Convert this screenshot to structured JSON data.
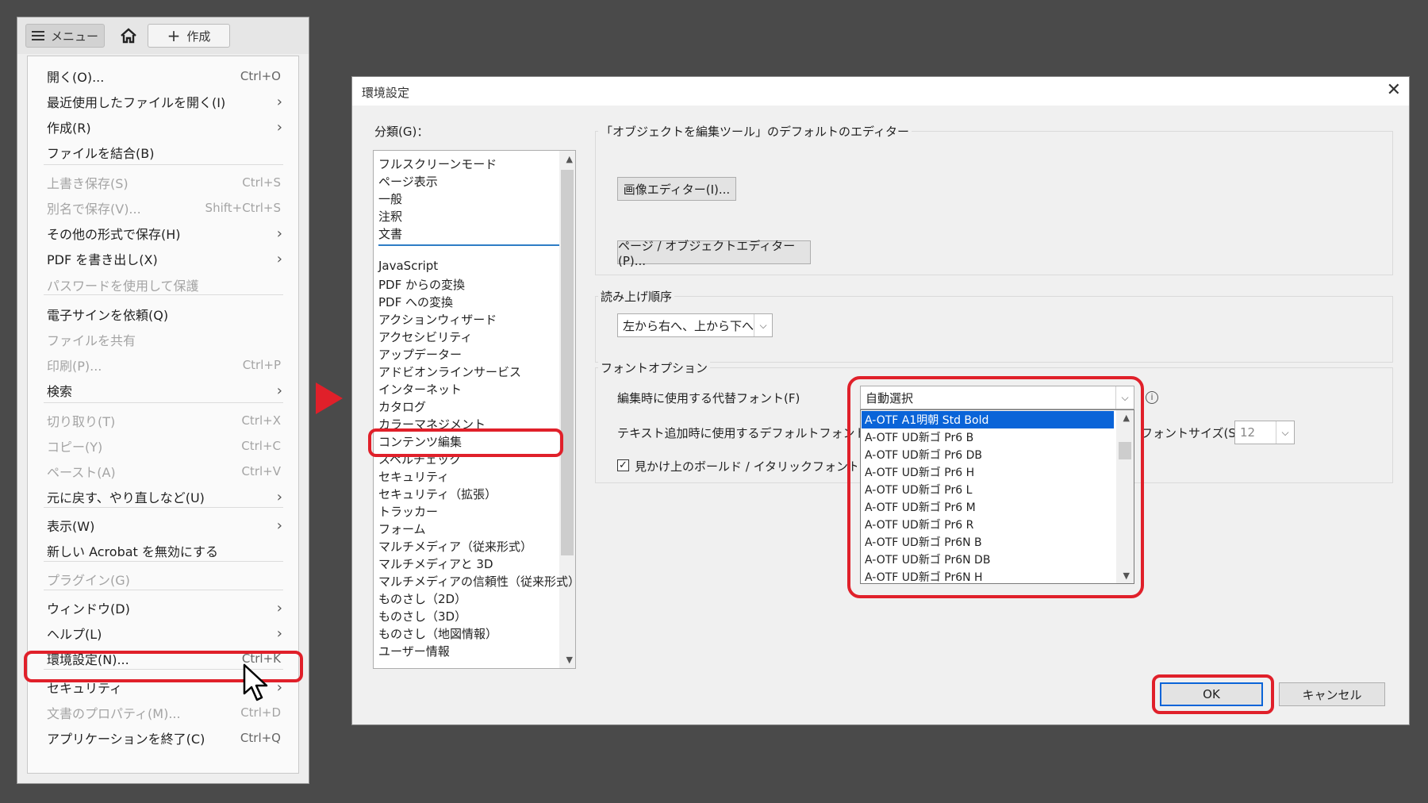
{
  "toolbar": {
    "menu_label": "メニュー",
    "create_label": "作成",
    "home_icon": "home-icon"
  },
  "menu": {
    "items": [
      {
        "label": "開く(O)...",
        "shortcut": "Ctrl+O",
        "submenu": false,
        "disabled": false
      },
      {
        "label": "最近使用したファイルを開く(I)",
        "shortcut": "",
        "submenu": true,
        "disabled": false
      },
      {
        "label": "作成(R)",
        "shortcut": "",
        "submenu": true,
        "disabled": false
      },
      {
        "label": "ファイルを結合(B)",
        "shortcut": "",
        "submenu": false,
        "disabled": false
      },
      {
        "label": "上書き保存(S)",
        "shortcut": "Ctrl+S",
        "submenu": false,
        "disabled": true
      },
      {
        "label": "別名で保存(V)...",
        "shortcut": "Shift+Ctrl+S",
        "submenu": false,
        "disabled": true
      },
      {
        "label": "その他の形式で保存(H)",
        "shortcut": "",
        "submenu": true,
        "disabled": false
      },
      {
        "label": "PDF を書き出し(X)",
        "shortcut": "",
        "submenu": true,
        "disabled": false
      },
      {
        "label": "パスワードを使用して保護",
        "shortcut": "",
        "submenu": false,
        "disabled": true
      },
      {
        "label": "電子サインを依頼(Q)",
        "shortcut": "",
        "submenu": false,
        "disabled": false
      },
      {
        "label": "ファイルを共有",
        "shortcut": "",
        "submenu": false,
        "disabled": true
      },
      {
        "label": "印刷(P)...",
        "shortcut": "Ctrl+P",
        "submenu": false,
        "disabled": true
      },
      {
        "label": "検索",
        "shortcut": "",
        "submenu": true,
        "disabled": false
      },
      {
        "label": "切り取り(T)",
        "shortcut": "Ctrl+X",
        "submenu": false,
        "disabled": true
      },
      {
        "label": "コピー(Y)",
        "shortcut": "Ctrl+C",
        "submenu": false,
        "disabled": true
      },
      {
        "label": "ペースト(A)",
        "shortcut": "Ctrl+V",
        "submenu": false,
        "disabled": true
      },
      {
        "label": "元に戻す、やり直しなど(U)",
        "shortcut": "",
        "submenu": true,
        "disabled": false
      },
      {
        "label": "表示(W)",
        "shortcut": "",
        "submenu": true,
        "disabled": false
      },
      {
        "label": "新しい Acrobat を無効にする",
        "shortcut": "",
        "submenu": false,
        "disabled": false
      },
      {
        "label": "プラグイン(G)",
        "shortcut": "",
        "submenu": false,
        "disabled": true
      },
      {
        "label": "ウィンドウ(D)",
        "shortcut": "",
        "submenu": true,
        "disabled": false
      },
      {
        "label": "ヘルプ(L)",
        "shortcut": "",
        "submenu": true,
        "disabled": false
      },
      {
        "label": "環境設定(N)...",
        "shortcut": "Ctrl+K",
        "submenu": false,
        "disabled": false
      },
      {
        "label": "セキュリティ",
        "shortcut": "",
        "submenu": true,
        "disabled": false
      },
      {
        "label": "文書のプロパティ(M)...",
        "shortcut": "Ctrl+D",
        "submenu": false,
        "disabled": true
      },
      {
        "label": "アプリケーションを終了(C)",
        "shortcut": "Ctrl+Q",
        "submenu": false,
        "disabled": false
      }
    ]
  },
  "dialog": {
    "title": "環境設定",
    "category_label": "分類(G)：",
    "categories_top": [
      "フルスクリーンモード",
      "ページ表示",
      "一般",
      "注釈",
      "文書"
    ],
    "categories": [
      "JavaScript",
      "PDF からの変換",
      "PDF への変換",
      "アクションウィザード",
      "アクセシビリティ",
      "アップデーター",
      "アドビオンラインサービス",
      "インターネット",
      "カタログ",
      "カラーマネジメント",
      "コンテンツ編集",
      "スペルチェック",
      "セキュリティ",
      "セキュリティ（拡張）",
      "トラッカー",
      "フォーム",
      "マルチメディア（従来形式）",
      "マルチメディアと 3D",
      "マルチメディアの信頼性（従来形式）",
      "ものさし（2D）",
      "ものさし（3D）",
      "ものさし（地図情報）",
      "ユーザー情報"
    ],
    "selected_category": "コンテンツ編集",
    "editor_group_title": "「オブジェクトを編集ツール」のデフォルトのエディター",
    "image_editor_button": "画像エディター(I)...",
    "page_editor_button": "ページ / オブジェクトエディター(P)...",
    "reading_group_title": "読み上げ順序",
    "reading_order_value": "左から右へ、上から下へ",
    "font_group_title": "フォントオプション",
    "fallback_font_label": "編集時に使用する代替フォント(F)",
    "fallback_font_value": "自動選択",
    "default_font_label": "テキスト追加時に使用するデフォルトフォント(A)",
    "font_size_label": "フォントサイズ(S)",
    "font_size_value": "12",
    "faux_style_label": "見かけ上のボールド / イタリックフォントスタイル",
    "font_options": [
      "A-OTF A1明朝 Std Bold",
      "A-OTF UD新ゴ Pr6 B",
      "A-OTF UD新ゴ Pr6 DB",
      "A-OTF UD新ゴ Pr6 H",
      "A-OTF UD新ゴ Pr6 L",
      "A-OTF UD新ゴ Pr6 M",
      "A-OTF UD新ゴ Pr6 R",
      "A-OTF UD新ゴ Pr6N B",
      "A-OTF UD新ゴ Pr6N DB",
      "A-OTF UD新ゴ Pr6N H"
    ],
    "ok_button": "OK",
    "cancel_button": "キャンセル"
  },
  "colors": {
    "highlight": "#e0202a",
    "selection": "#0a64d8",
    "accent_divider": "#2e7dc5"
  }
}
